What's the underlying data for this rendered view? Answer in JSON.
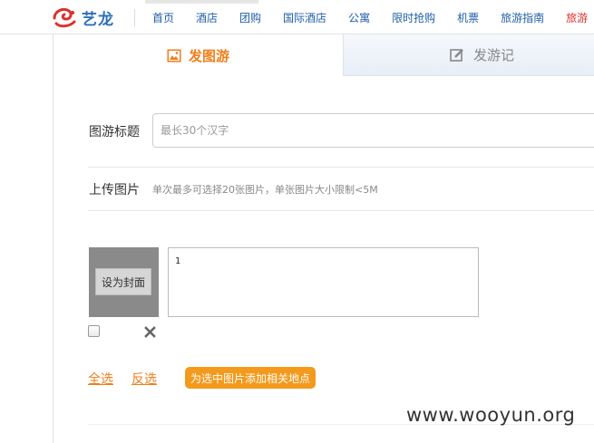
{
  "header": {
    "logo_text": "艺龙",
    "nav": [
      "首页",
      "酒店",
      "团购",
      "国际酒店",
      "公寓",
      "限时抢购",
      "机票",
      "旅游指南",
      "旅游"
    ]
  },
  "tabs": {
    "active_label": "发图游",
    "inactive_label": "发游记"
  },
  "form": {
    "title_label": "图游标题",
    "title_placeholder": "最长30个汉字",
    "upload_label": "上传图片",
    "upload_hint": "单次最多可选择20张图片，单张图片大小限制<5M"
  },
  "photo": {
    "cover_button": "设为封面",
    "description": "1"
  },
  "actions": {
    "select_all": "全选",
    "invert": "反选",
    "add_location": "为选中图片添加相关地点"
  },
  "watermark": "www.wooyun.org",
  "colors": {
    "accent": "#f17e1a",
    "nav_link": "#1f5fa8"
  }
}
